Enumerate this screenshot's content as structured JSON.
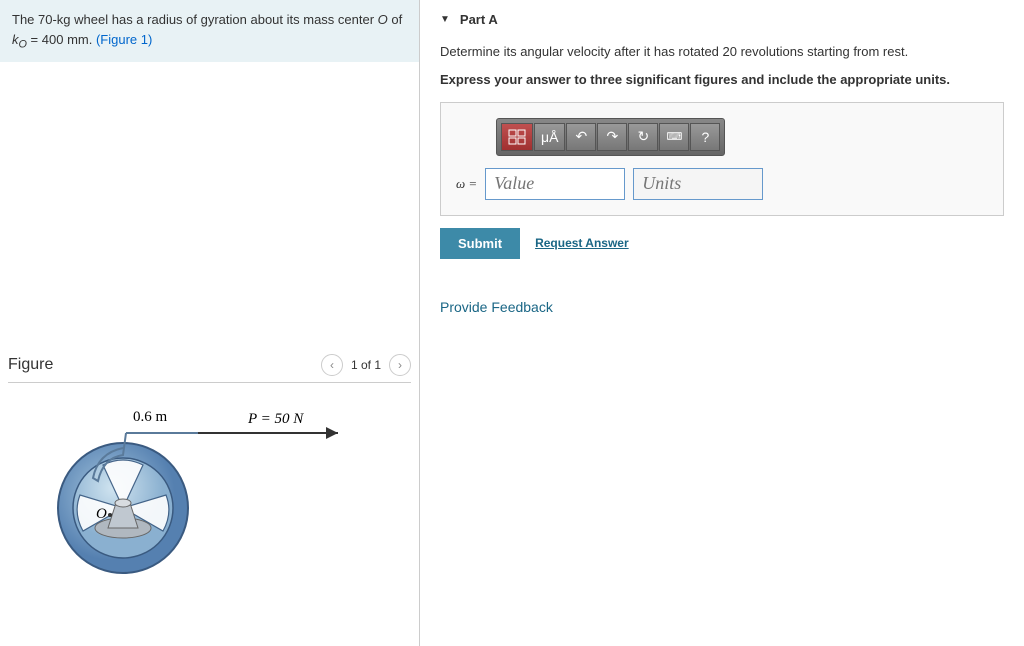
{
  "problem": {
    "prefix": "The ",
    "mass": "70-kg",
    "mid1": " wheel has a radius of gyration about its mass center ",
    "o_label": "O",
    "of": " of ",
    "ko": "k",
    "ko_sub": "O",
    "equals": " = ",
    "value": "400 mm",
    "suffix": ". ",
    "figure_ref": "(Figure 1)"
  },
  "figure": {
    "title": "Figure",
    "nav_text": "1 of 1",
    "radius_label": "0.6 m",
    "force_label": "P = 50 N",
    "center_label": "O"
  },
  "part": {
    "label": "Part A",
    "question": "Determine its angular velocity after it has rotated 20 revolutions starting from rest.",
    "instruction": "Express your answer to three significant figures and include the appropriate units."
  },
  "toolbar": {
    "mu_a": "μÅ",
    "undo": "↶",
    "redo": "↷",
    "reset": "↻",
    "keyboard": "⌨",
    "help": "?"
  },
  "input": {
    "omega": "ω =",
    "value_placeholder": "Value",
    "units_placeholder": "Units"
  },
  "actions": {
    "submit": "Submit",
    "request": "Request Answer"
  },
  "feedback": "Provide Feedback"
}
